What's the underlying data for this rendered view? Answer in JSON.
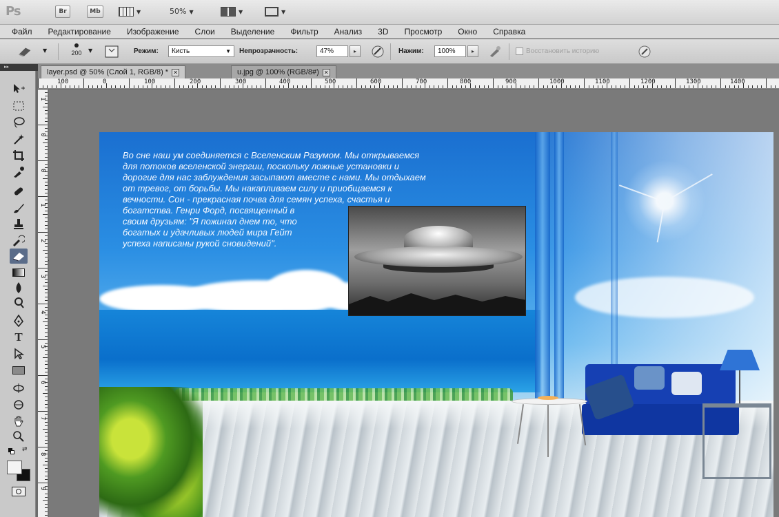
{
  "app": {
    "logo": "Ps",
    "bridge_btn": "Br",
    "minibridge_btn": "Mb",
    "zoom": "50%"
  },
  "menu": [
    "Файл",
    "Редактирование",
    "Изображение",
    "Слои",
    "Выделение",
    "Фильтр",
    "Анализ",
    "3D",
    "Просмотр",
    "Окно",
    "Справка"
  ],
  "options": {
    "brush_size": "200",
    "mode_label": "Режим:",
    "mode_value": "Кисть",
    "opacity_label": "Непрозрачность:",
    "opacity_value": "47%",
    "pressure_label": "Нажим:",
    "pressure_value": "100%",
    "restore_label": "Восстановить историю"
  },
  "tabs": [
    {
      "label": "layer.psd @ 50% (Слой 1, RGB/8) *"
    },
    {
      "label": "u.jpg @ 100% (RGB/8#)"
    }
  ],
  "ruler_h": [
    "100",
    "0",
    "100",
    "200",
    "300",
    "400",
    "500",
    "600",
    "700",
    "800",
    "900",
    "1000",
    "1100",
    "1200",
    "1300",
    "1400"
  ],
  "ruler_v": [
    "1",
    "0",
    "0",
    "1",
    "2",
    "3",
    "4",
    "5",
    "6",
    "7",
    "8",
    "9",
    "1",
    "1"
  ],
  "canvas_text": [
    "Во сне наш ум соединяется с Вселенским Разумом. Мы открываемся",
    "для потоков вселенской энергии, поскольку ложные установки и",
    "дорогие для нас заблуждения засыпают вместе с нами. Мы отдыхаем",
    "от тревог, от борьбы. Мы накапливаем силу и приобщаемся к",
    "вечности. Сон - прекрасная почва для семян успеха, счастья и",
    "богатства. Генри Форд, посвященный в",
    "своим друзьям: \"Я пожинал днем то, что",
    "богатых и удачливых людей мира Гейт",
    "успеха написаны рукой сновидений\"."
  ],
  "colors": {
    "selected_tool": "#5a6c89",
    "sky": "#2a8ee3",
    "sofa": "#1640b3"
  }
}
